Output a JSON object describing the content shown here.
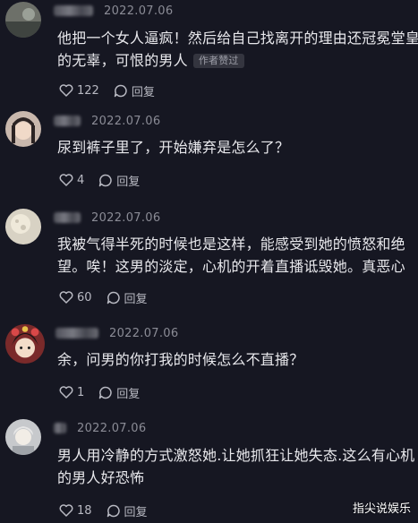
{
  "comments": [
    {
      "date": "2022.07.06",
      "line1": "他把一个女人逼疯！然后给自己找离开的理由还冠冕堂皇",
      "line2": "的无辜，可恨的男人",
      "badge": "作者赞过",
      "likes": "122",
      "reply": "回复",
      "avatar_icon": "avatar-landscape"
    },
    {
      "date": "2022.07.06",
      "line1": "尿到裤子里了，开始嫌弃是怎么了？",
      "likes": "4",
      "reply": "回复",
      "avatar_icon": "avatar-person"
    },
    {
      "date": "2022.07.06",
      "line1": "我被气得半死的时候也是这样，能感受到她的愤怒和绝",
      "line2": "望。唉！这男的淡定，心机的开着直播诋毁她。真恶心",
      "likes": "60",
      "reply": "回复",
      "avatar_icon": "avatar-moon"
    },
    {
      "date": "2022.07.06",
      "line1": "余，问男的你打我的时候怎么不直播？",
      "likes": "1",
      "reply": "回复",
      "avatar_icon": "avatar-cartoon"
    },
    {
      "date": "2022.07.06",
      "line1": "男人用冷静的方式激怒她.让她抓狂让她失态.这么有心机",
      "line2": "的男人好恐怖",
      "likes": "18",
      "reply": "回复",
      "avatar_icon": "avatar-girl"
    }
  ],
  "watermark": "指尖说娱乐"
}
